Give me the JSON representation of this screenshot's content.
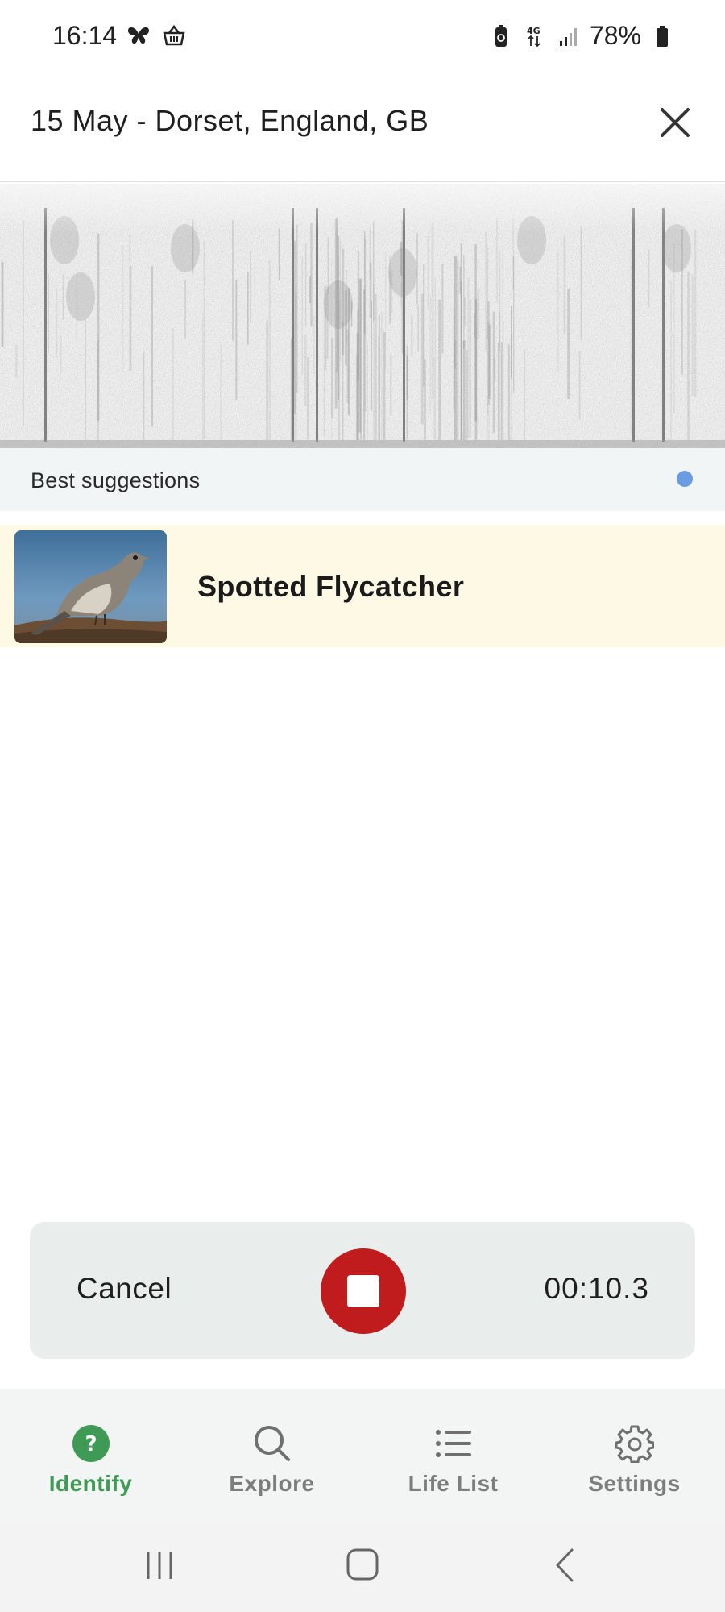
{
  "status_bar": {
    "time": "16:14",
    "network": "4G",
    "battery_percent": "78%",
    "left_icons": [
      "butterfly-icon",
      "basket-icon"
    ],
    "right_icons": [
      "battery-saver-icon",
      "network-4g-icon",
      "signal-icon",
      "battery-icon"
    ]
  },
  "header": {
    "title": "15 May - Dorset, England, GB",
    "close_icon": "close-icon"
  },
  "suggestions": {
    "label": "Best suggestions",
    "indicator_color": "#6b9be0",
    "items": [
      {
        "name": "Spotted Flycatcher",
        "thumbnail": "bird-photo"
      }
    ]
  },
  "recording": {
    "cancel_label": "Cancel",
    "timer": "00:10.3",
    "stop_icon": "stop-icon",
    "stop_color": "#c01c1e"
  },
  "bottom_nav": {
    "active_color": "#3f9a55",
    "items": [
      {
        "label": "Identify",
        "icon": "question-circle-icon",
        "active": true
      },
      {
        "label": "Explore",
        "icon": "search-icon",
        "active": false
      },
      {
        "label": "Life List",
        "icon": "list-icon",
        "active": false
      },
      {
        "label": "Settings",
        "icon": "gear-icon",
        "active": false
      }
    ]
  },
  "system_nav": {
    "icons": [
      "recent-apps-icon",
      "home-icon",
      "back-icon"
    ]
  }
}
